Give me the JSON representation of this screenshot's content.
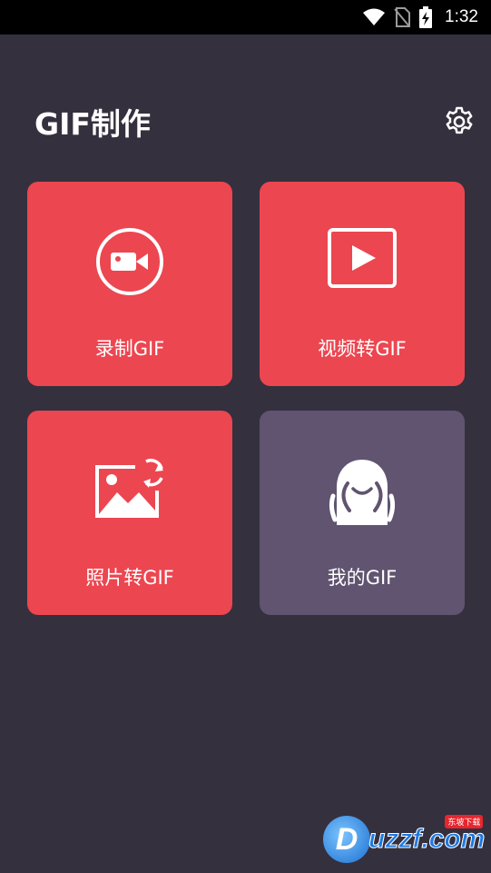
{
  "status_bar": {
    "time": "1:32",
    "icons": [
      "wifi-icon",
      "no-sim-icon",
      "battery-charging-icon"
    ]
  },
  "header": {
    "title": "GIF制作",
    "settings_icon": "gear-icon"
  },
  "cards": [
    {
      "id": "record",
      "label": "录制GIF",
      "icon": "video-camera-icon",
      "color": "#ec4650"
    },
    {
      "id": "video",
      "label": "视频转GIF",
      "icon": "play-icon",
      "color": "#ec4650"
    },
    {
      "id": "photo",
      "label": "照片转GIF",
      "icon": "image-refresh-icon",
      "color": "#ec4650"
    },
    {
      "id": "mine",
      "label": "我的GIF",
      "icon": "ghost-mascot-icon",
      "color": "#605470"
    }
  ],
  "watermark": {
    "logo_letter": "D",
    "text": "uzzf.com",
    "badge": "东坡下载"
  },
  "colors": {
    "background": "#35303e",
    "status_bar": "#000000",
    "accent": "#ec4650",
    "secondary_card": "#605470",
    "text": "#ffffff"
  }
}
